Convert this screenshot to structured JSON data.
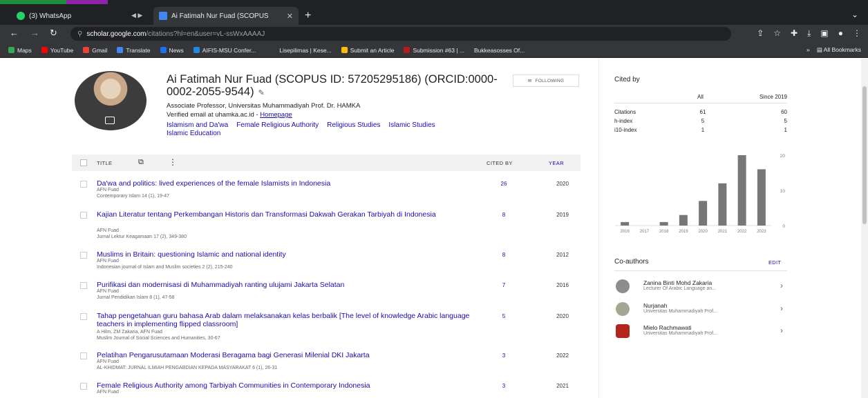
{
  "browser": {
    "tabs": [
      {
        "label": "(3) WhatsApp",
        "favicon_color": "#25d366"
      },
      {
        "label": "Ai Fatimah Nur Fuad (SCOPUS",
        "favicon_color": "#4285f4"
      }
    ],
    "url_host": "scholar.google.com",
    "url_path": "/citations?hl=en&user=vL-ssWxAAAAJ",
    "bookmarks": [
      {
        "label": "Maps",
        "color": "#34a853"
      },
      {
        "label": "YouTube",
        "color": "#ff0000"
      },
      {
        "label": "Gmail",
        "color": "#ea4335"
      },
      {
        "label": "Translate",
        "color": "#4285f4"
      },
      {
        "label": "News",
        "color": "#1a73e8"
      },
      {
        "label": "AIFIS-MSU Confer...",
        "color": "#1e88e5"
      },
      {
        "label": "Lisepilimas | Kese...",
        "color": "#5f6368"
      },
      {
        "label": "Submit an Article",
        "color": "#fbbc05"
      },
      {
        "label": "Submission #63 | ...",
        "color": "#b71c1c"
      },
      {
        "label": "Bukkeasosses Of...",
        "color": "#5f6368"
      }
    ],
    "all_bookmarks": "All Bookmarks"
  },
  "profile": {
    "name": "Ai Fatimah Nur Fuad (SCOPUS ID: 57205295186) (ORCID:0000-0002-2055-9544)",
    "follow_label": "FOLLOWING",
    "affiliation": "Associate Professor, Universitas Muhammadiyah Prof. Dr. HAMKA",
    "verified_email": "Verified email at uhamka.ac.id -",
    "homepage": "Homepage",
    "interests": [
      "Islamism and Da'wa",
      "Female Religious Authority",
      "Religious Studies",
      "Islamic Studies",
      "Islamic Education"
    ]
  },
  "table": {
    "title_header": "TITLE",
    "cited_by_header": "CITED BY",
    "year_header": "YEAR",
    "rows": [
      {
        "title": "Da'wa and politics: lived experiences of the female Islamists in Indonesia",
        "authors": "AFN Fuad",
        "venue": "Contemporary Islam 14 (1), 19-47",
        "cites": "26",
        "year": "2020"
      },
      {
        "title": "Kajian Literatur tentang Perkembangan Historis dan Transformasi Dakwah Gerakan Tarbiyah di Indonesia",
        "authors": "AFN Fuad",
        "venue": "Jurnal Lektur Keagamaan 17 (2), 349-380",
        "cites": "8",
        "year": "2019"
      },
      {
        "title": "Muslims in Britain: questioning Islamic and national identity",
        "authors": "AFN Fuad",
        "venue": "Indonesian journal of Islam and Muslim societies 2 (2), 215-240",
        "cites": "8",
        "year": "2012"
      },
      {
        "title": "Purifikasi dan modernisasi di Muhammadiyah ranting ulujami Jakarta Selatan",
        "authors": "AFN Fuad",
        "venue": "Jurnal Pendidikan Islam 8 (1), 47-58",
        "cites": "7",
        "year": "2016"
      },
      {
        "title": "Tahap pengetahuan guru bahasa Arab dalam melaksanakan kelas berbalik [The level of knowledge Arabic language teachers in implementing flipped classroom]",
        "authors": "A Hilm, ZM Zakaria, AFN Fuad",
        "venue": "Muslim Journal of Social Sciences and Humanities, 30-67",
        "cites": "5",
        "year": "2020"
      },
      {
        "title": "Pelatihan Pengarusutamaan Moderasi Beragama bagi Generasi Milenial DKI Jakarta",
        "authors": "AFN Fuad",
        "venue": "AL-KHIDMAT: JURNAL ILMIAH PENGABDIAN KEPADA MASYARAKAT 6 (1), 26-31",
        "cites": "3",
        "year": "2022"
      },
      {
        "title": "Female Religious Authority among Tarbiyah Communities in Contemporary Indonesia",
        "authors": "AFN Fuad",
        "venue": "",
        "cites": "3",
        "year": "2021"
      }
    ]
  },
  "cited_by": {
    "title": "Cited by",
    "col_all": "All",
    "col_since": "Since 2019",
    "rows": [
      {
        "label": "Citations",
        "all": "61",
        "since": "60"
      },
      {
        "label": "h-index",
        "all": "5",
        "since": "5"
      },
      {
        "label": "i10-index",
        "all": "1",
        "since": "1"
      }
    ]
  },
  "chart_data": {
    "type": "bar",
    "categories": [
      "2016",
      "2017",
      "2018",
      "2019",
      "2020",
      "2021",
      "2022",
      "2023"
    ],
    "values": [
      1,
      0,
      1,
      3,
      7,
      12,
      20,
      16
    ],
    "ylim": [
      0,
      20
    ],
    "yticks": [
      "20",
      "10",
      "0"
    ],
    "bar_color": "#777777"
  },
  "coauthors": {
    "title": "Co-authors",
    "edit_label": "EDIT",
    "items": [
      {
        "name": "Zanina Binti Mohd Zakaria",
        "affiliation": "Lecturer Of Arabic Language an...",
        "avatar_color": "#8d8d8d"
      },
      {
        "name": "Nurjanah",
        "affiliation": "Universitas Muhammadiyah Prof...",
        "avatar_color": "#a5a595"
      },
      {
        "name": "Mielo Rachmawati",
        "affiliation": "Universitas Muhammadiyah Prof...",
        "avatar_color": "#b3261e"
      }
    ]
  }
}
